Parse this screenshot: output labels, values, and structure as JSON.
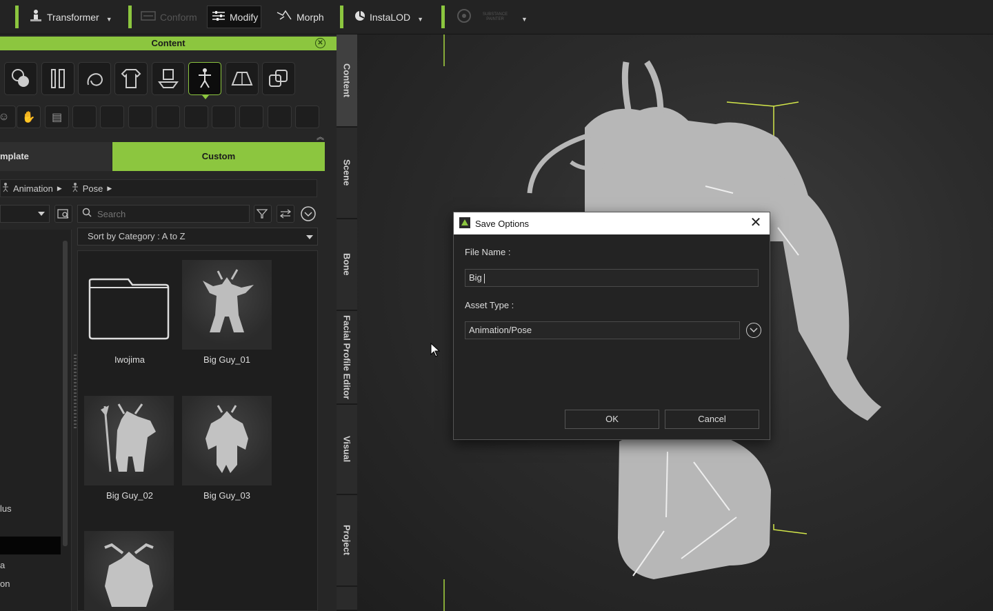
{
  "toolbar": {
    "transformer": "Transformer",
    "conform": "Conform",
    "modify": "Modify",
    "morph": "Morph",
    "instalod": "InstaLOD",
    "substance": "SUBSTANCE PAINTER"
  },
  "panel": {
    "title": "Content",
    "tab_template": "mplate",
    "tab_custom": "Custom",
    "breadcrumb": {
      "item1": "Animation",
      "item2": "Pose"
    },
    "search_placeholder": "Search",
    "sort_label": "Sort by Category : A to Z",
    "tree_items": [
      "lus",
      "a",
      "on"
    ],
    "items": [
      {
        "label": "Iwojima"
      },
      {
        "label": "Big Guy_01"
      },
      {
        "label": "Big Guy_02"
      },
      {
        "label": "Big Guy_03"
      }
    ]
  },
  "side_tabs": [
    "Content",
    "Scene",
    "Bone",
    "Facial Profile Editor",
    "Visual",
    "Project"
  ],
  "dialog": {
    "title": "Save Options",
    "file_name_label": "File Name :",
    "file_name_value": "Big",
    "asset_type_label": "Asset Type :",
    "asset_type_value": "Animation/Pose",
    "ok": "OK",
    "cancel": "Cancel"
  },
  "colors": {
    "accent": "#8cc63f",
    "panel_bg": "#262626",
    "dialog_bg": "#232323"
  }
}
